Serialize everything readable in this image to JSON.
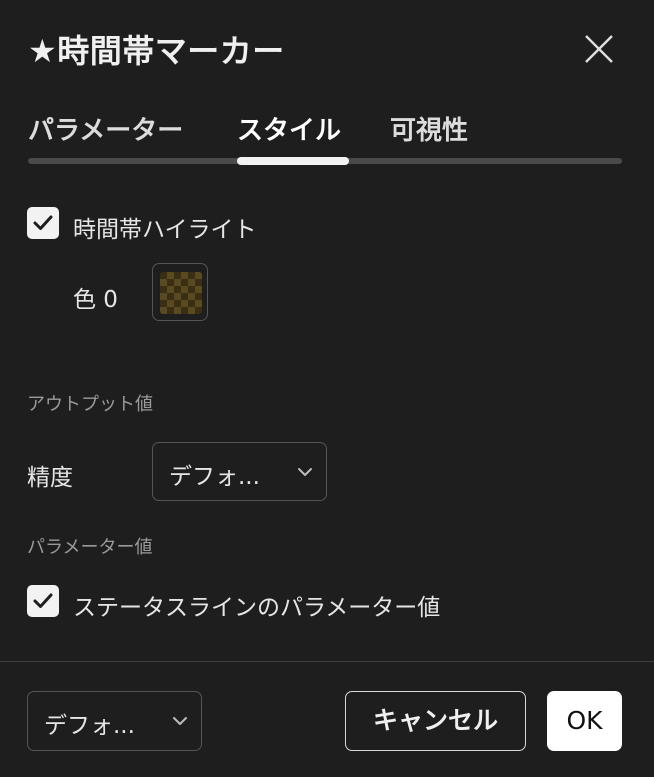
{
  "dialog": {
    "title": "★時間帯マーカー",
    "close_icon": "close-icon"
  },
  "tabs": [
    {
      "label": "パラメーター",
      "active": false
    },
    {
      "label": "スタイル",
      "active": true
    },
    {
      "label": "可視性",
      "active": false
    }
  ],
  "style": {
    "highlight": {
      "label": "時間帯ハイライト",
      "checked": true
    },
    "color": {
      "label": "色 0",
      "swatch_color": "#3a2f14"
    },
    "output_section": "アウトプット値",
    "precision": {
      "label": "精度",
      "value": "デフォ..."
    },
    "param_section": "パラメーター値",
    "status_line": {
      "label": "ステータスラインのパラメーター値",
      "checked": true
    }
  },
  "footer": {
    "template_value": "デフォ...",
    "cancel_label": "キャンセル",
    "ok_label": "OK"
  },
  "colors": {
    "background": "#1e1e1e",
    "accent": "#f2f2f2"
  }
}
